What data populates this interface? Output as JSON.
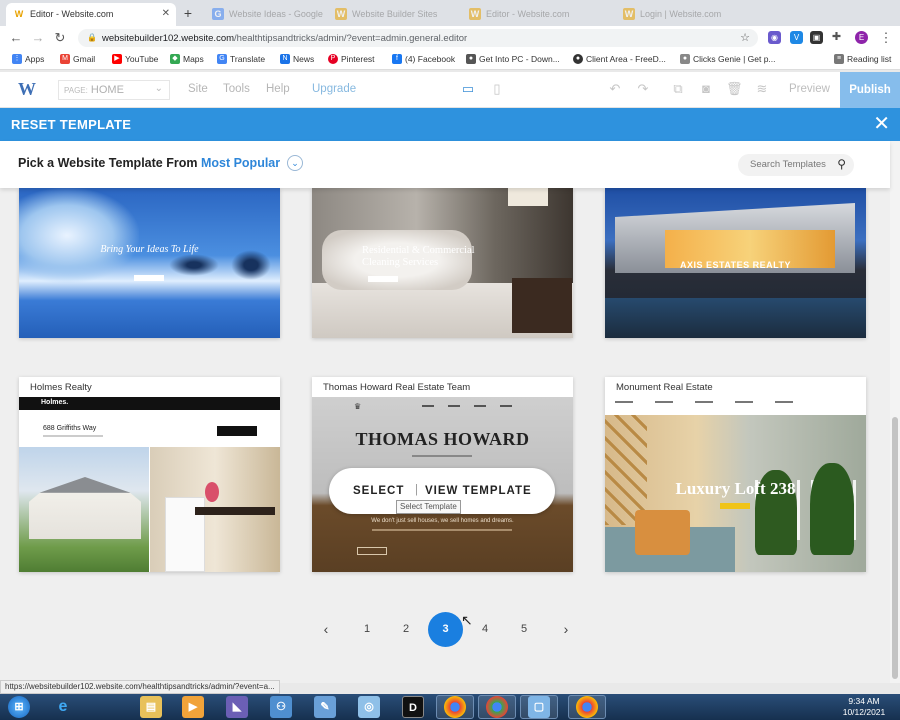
{
  "browser": {
    "active_tab": "Editor - Website.com",
    "tabs_faded": [
      "Website Ideas - Google",
      "Website Builder Sites",
      "Editor - Website.com",
      "Login | Website.com"
    ],
    "url_host": "websitebuilder102.website.com",
    "url_path": "/healthtipsandtricks/admin/?event=admin.general.editor",
    "bookmarks": [
      "Apps",
      "Gmail",
      "YouTube",
      "Maps",
      "Translate",
      "News",
      "Pinterest",
      "(4) Facebook",
      "Get Into PC - Down...",
      "Client Area - FreeD...",
      "Clicks Genie | Get p..."
    ],
    "reading_list": "Reading list",
    "profile_initial": "E"
  },
  "editor": {
    "logo": "W",
    "page_label": "PAGE:",
    "page_value": "HOME",
    "menu": [
      "Site",
      "Tools",
      "Help"
    ],
    "upgrade": "Upgrade",
    "preview": "Preview",
    "publish": "Publish"
  },
  "reset_bar": {
    "title": "RESET TEMPLATE",
    "close": "✕"
  },
  "template_header": {
    "pick_prefix": "Pick a Website Template From",
    "sort_value": "Most Popular",
    "search_placeholder": "Search Templates"
  },
  "templates": {
    "row1": [
      {
        "overlay": "Bring Your Ideas To Life"
      },
      {
        "overlay": "Residential & Commercial Cleaning Services"
      },
      {
        "overlay": "AXIS ESTATES REALTY"
      }
    ],
    "row2": [
      {
        "caption": "Holmes Realty",
        "logo": "Holmes.",
        "address": "688 Griffiths Way"
      },
      {
        "caption": "Thomas Howard Real Estate Team",
        "headline": "THOMAS HOWARD",
        "body": "We don't just sell houses, we sell homes and dreams."
      },
      {
        "caption": "Monument Real Estate",
        "headline": "Luxury Loft 238"
      }
    ]
  },
  "overlay": {
    "select": "SELECT",
    "separator": "|",
    "view": "VIEW TEMPLATE",
    "tooltip": "Select Template"
  },
  "pagination": {
    "prev": "‹",
    "pages": [
      "1",
      "2",
      "3",
      "4",
      "5"
    ],
    "current": "3",
    "next": "›"
  },
  "status_url": "https://websitebuilder102.website.com/healthtipsandtricks/admin/?event=a...",
  "clock": {
    "time": "9:34 AM",
    "date": "10/12/2021"
  },
  "colors": {
    "accent": "#2e92de",
    "page_current": "#1a7fe0",
    "publish": "#86bdec"
  }
}
